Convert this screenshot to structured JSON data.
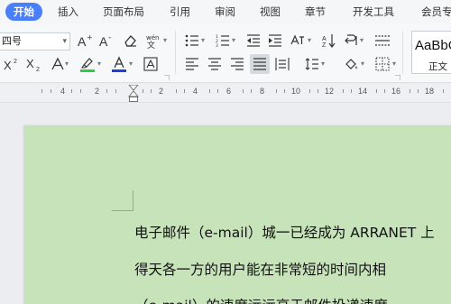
{
  "menu": {
    "tabs": [
      {
        "label": "开始",
        "active": true
      },
      {
        "label": "插入"
      },
      {
        "label": "页面布局"
      },
      {
        "label": "引用"
      },
      {
        "label": "审阅"
      },
      {
        "label": "视图"
      },
      {
        "label": "章节"
      },
      {
        "label": "开发工具"
      },
      {
        "label": "会员专"
      }
    ]
  },
  "ribbon": {
    "font_size": "四号",
    "font_size_icon": "chevron-down-icon",
    "styles": {
      "sample": "AaBbC",
      "name": "正文"
    },
    "colors": {
      "highlight": "#2ecc40",
      "font_color": "#1f3fd9",
      "accent": "#4a7ffa"
    }
  },
  "ruler": {
    "labels": [
      "4",
      "2",
      "2",
      "4",
      "6",
      "8",
      "10",
      "12",
      "14",
      "16",
      "18"
    ]
  },
  "document": {
    "lines": [
      "电子邮件（e-mail）城一已经成为 ARRANET 上",
      "得天各一方的用户能在非常短的时间内相",
      "（e-mail）的速度远远高于邮件投递速度"
    ],
    "page_color": "#c7e3b9"
  }
}
